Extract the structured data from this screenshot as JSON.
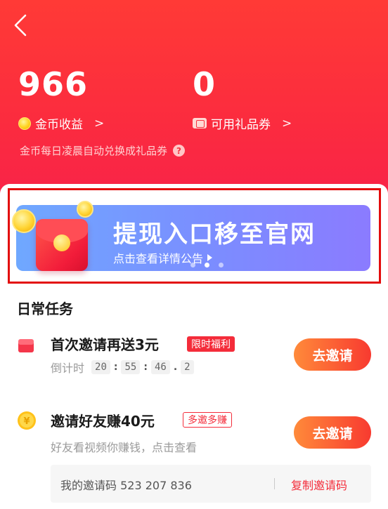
{
  "stats": {
    "coins_value": "966",
    "coins_label": "金币收益",
    "coupons_value": "0",
    "coupons_label": "可用礼品券",
    "hint": "金币每日凌晨自动兑换成礼品券"
  },
  "banner": {
    "title": "提现入口移至官网",
    "subtitle": "点击查看详情公告",
    "page_count": 3,
    "active_page": 1
  },
  "section": {
    "title": "日常任务"
  },
  "tasks": [
    {
      "title": "首次邀请再送3元",
      "tag": "限时福利",
      "desc_prefix": "倒计时",
      "countdown": [
        "20",
        "55",
        "46",
        "2"
      ],
      "button": "去邀请"
    },
    {
      "title": "邀请好友赚40元",
      "tag": "多邀多赚",
      "desc": "好友看视频你赚钱，点击查看",
      "button": "去邀请",
      "invite_code_label": "我的邀请码 523 207 836",
      "copy_label": "复制邀请码"
    }
  ],
  "colors": {
    "header_red": "#fb2b3f",
    "accent_red": "#f42c3a",
    "banner_blue": "#7b8dff",
    "button_orange": "#ff8a3a"
  }
}
